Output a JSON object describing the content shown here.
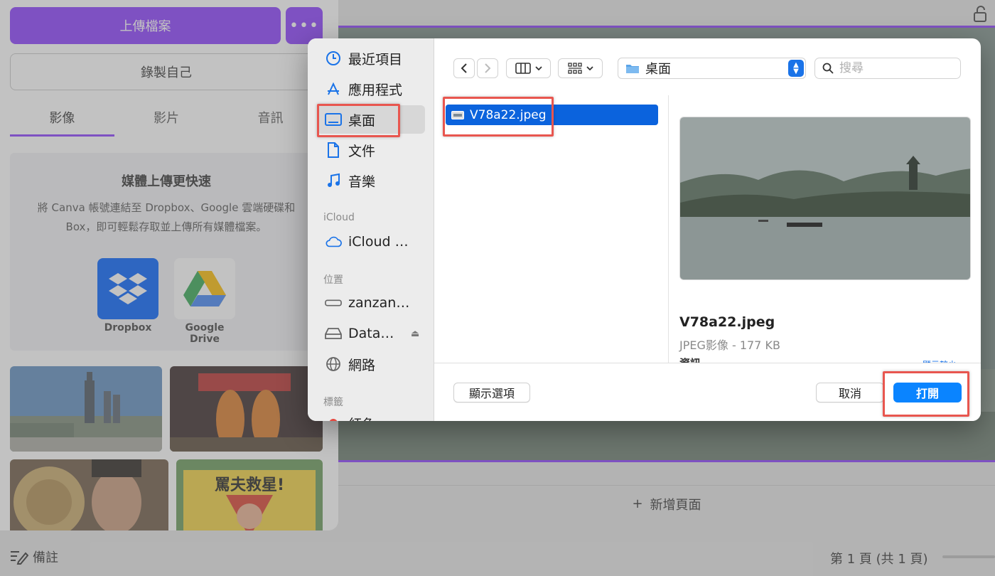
{
  "canva": {
    "upload_label": "上傳檔案",
    "more_label": "•••",
    "record_label": "錄製自己",
    "tabs": [
      {
        "label": "影像"
      },
      {
        "label": "影片"
      },
      {
        "label": "音訊"
      }
    ],
    "promo_title": "媒體上傳更快速",
    "promo_desc": "將 Canva 帳號連結至 Dropbox、Google 雲端硬碟和 Box，即可輕鬆存取並上傳所有媒體檔案。",
    "services": [
      {
        "label": "Dropbox",
        "icon": "dropbox-icon"
      },
      {
        "label": "Google Drive",
        "icon": "google-drive-icon"
      }
    ],
    "thumb_text": "罵夫救星!",
    "notes_label": "備註",
    "add_page_label": "新增頁面",
    "page_indicator": "第 1 頁 (共 1 頁)"
  },
  "dialog": {
    "sidebar": {
      "favorites": [
        {
          "label": "最近項目",
          "icon": "clock-icon"
        },
        {
          "label": "應用程式",
          "icon": "apps-icon"
        },
        {
          "label": "桌面",
          "icon": "desktop-icon",
          "selected": true
        },
        {
          "label": "文件",
          "icon": "document-icon"
        },
        {
          "label": "音樂",
          "icon": "music-icon"
        }
      ],
      "icloud_section": "iCloud",
      "icloud_items": [
        {
          "label": "iCloud …",
          "icon": "cloud-icon"
        }
      ],
      "locations_section": "位置",
      "locations": [
        {
          "label": "zanzan…",
          "icon": "drive-icon"
        },
        {
          "label": "Data…",
          "icon": "disk-icon",
          "eject": "⏏"
        },
        {
          "label": "網路",
          "icon": "globe-icon"
        }
      ],
      "tags_section": "標籤",
      "tag_partial": "紅色"
    },
    "toolbar": {
      "location": "桌面",
      "search_placeholder": "搜尋"
    },
    "files": [
      {
        "name": "V78a22.jpeg",
        "selected": true
      }
    ],
    "preview": {
      "name": "V78a22.jpeg",
      "meta": "JPEG影像 - 177 KB",
      "info_label": "資訊",
      "more_label": "顯示較少"
    },
    "buttons": {
      "options": "顯示選項",
      "cancel": "取消",
      "open": "打開"
    }
  },
  "colors": {
    "canva_purple": "#8b3dff",
    "mac_blue": "#0a84ff",
    "selection_blue": "#0b63dd",
    "highlight_red": "#e8564f"
  }
}
